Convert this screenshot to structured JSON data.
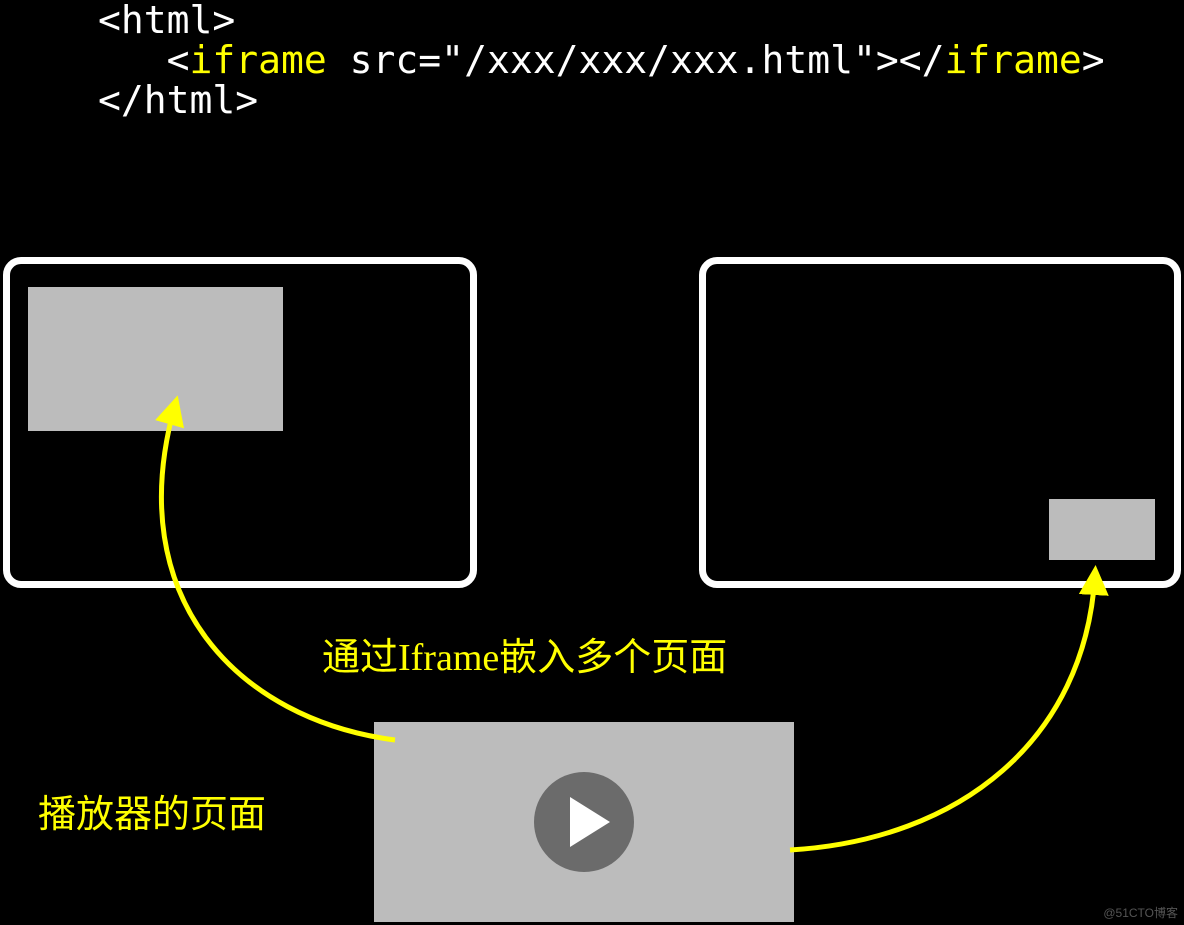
{
  "code": {
    "line1_open": "<html>",
    "indent": "   <",
    "tag_open": "iframe",
    "middle": " src=\"/xxx/xxx/xxx.html\"></",
    "tag_close": "iframe",
    "close_bracket": ">",
    "line3_close": "</html>"
  },
  "caption_center": "通过Iframe嵌入多个页面",
  "caption_left": "播放器的页面",
  "watermark": "@51CTO博客"
}
